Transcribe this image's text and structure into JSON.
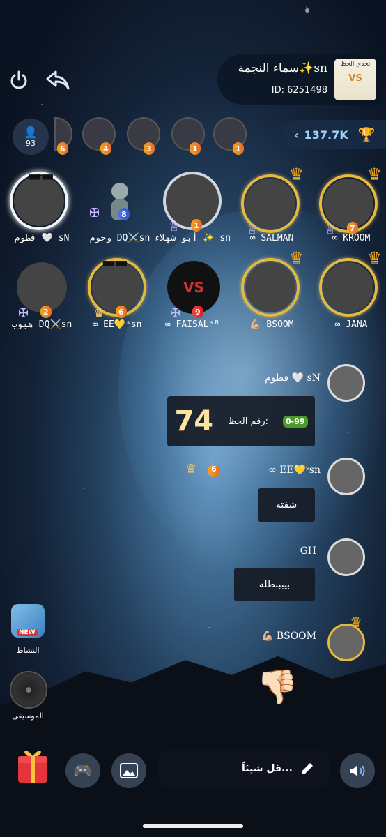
{
  "header": {
    "room_title": "سماء النجمة✨sn",
    "room_id": "ID: 6251498",
    "thumb_label": "تحدي الحظ"
  },
  "stats": {
    "trophy_value": "137.7K",
    "viewer_count": "93"
  },
  "top_viewers": [
    {
      "badge": "1"
    },
    {
      "badge": "1"
    },
    {
      "badge": "3"
    },
    {
      "badge": "4"
    },
    {
      "badge": "6"
    }
  ],
  "seats": [
    {
      "name": "∞ KROOM",
      "level": "7"
    },
    {
      "name": "∞ SALMAN",
      "level": ""
    },
    {
      "name": "أبو شهلاء ✨ sn",
      "level": "1"
    },
    {
      "name": "وحوم DQ⚔️sn",
      "level": "8"
    },
    {
      "name": "فطوم 🤍 sN",
      "level": ""
    },
    {
      "name": "∞ JANA",
      "level": ""
    },
    {
      "name": "💪🏼 BSOOM",
      "level": ""
    },
    {
      "name": "∞ FAISALˢᴺ",
      "level": "9"
    },
    {
      "name": "∞ EE💛ˢsn",
      "level": "6"
    },
    {
      "name": "هبوب DQ⚔️sn",
      "level": "2"
    }
  ],
  "chat": {
    "m1_name": "فطوم 🤍 sN",
    "lucky_label": "رقم الحظ:",
    "lucky_number": "74",
    "lucky_badge": "0-99",
    "m2_name": "∞ EE💛ˢsn",
    "m2_level": "6",
    "m2_text": "شفته",
    "m3_name": "GH",
    "m3_text": "بيبببطله",
    "m4_name": "💪🏼 BSOOM",
    "m4_text": "👎🏻"
  },
  "sidebar": {
    "activity_label": "النشاط",
    "activity_badge": "NEW",
    "music_label": "الموسيقى"
  },
  "composer": {
    "placeholder": "قل شيئاً..."
  },
  "colors": {
    "gold": "#e5b93b",
    "level_orange": "#f2a521",
    "trophy_blue": "#9fd3ff"
  }
}
